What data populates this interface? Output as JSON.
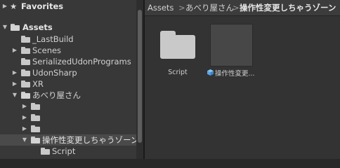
{
  "sidebar": {
    "favorites_label": "Favorites",
    "assets_label": "Assets",
    "items": [
      {
        "label": "_LastBuild"
      },
      {
        "label": "Scenes"
      },
      {
        "label": "SerializedUdonPrograms"
      },
      {
        "label": "UdonSharp"
      },
      {
        "label": "XR"
      },
      {
        "label": "あべり屋さん"
      },
      {
        "label": ""
      },
      {
        "label": ""
      },
      {
        "label": ""
      },
      {
        "label": "操作性変更しちゃうゾーン"
      },
      {
        "label": "Script"
      }
    ]
  },
  "breadcrumb": {
    "root": "Assets",
    "level1": "あべり屋さん",
    "level2": "操作性変更しちゃうゾーン",
    "separator": ">"
  },
  "content": {
    "folder_label": "Script",
    "asset_label": "操作性変更..."
  },
  "icons": {
    "star": "star-icon",
    "arrow_down": "▼",
    "arrow_right": "▶"
  },
  "colors": {
    "selection": "#4a4a4a",
    "folder": "#c8c8c8",
    "cube_accent": "#5aa7e6"
  }
}
